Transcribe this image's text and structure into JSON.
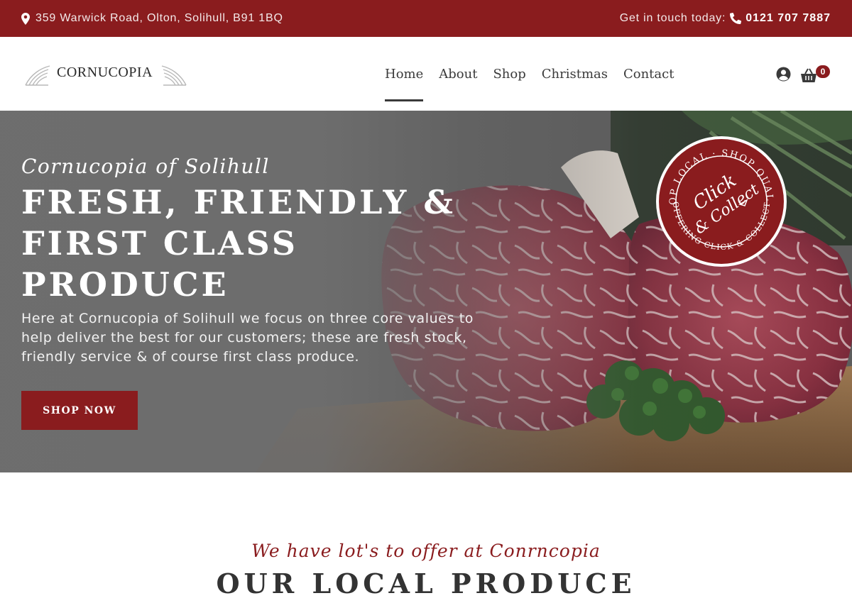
{
  "topbar": {
    "address": "359 Warwick Road, Olton, Solihull, B91 1BQ",
    "contact_prefix": "Get in touch today:",
    "phone": "0121 707 7887"
  },
  "header": {
    "logo_text": "CORNUCOPIA",
    "nav": [
      {
        "label": "Home",
        "active": true
      },
      {
        "label": "About"
      },
      {
        "label": "Shop"
      },
      {
        "label": "Christmas"
      },
      {
        "label": "Contact"
      }
    ],
    "cart_count": "0"
  },
  "hero": {
    "script_title": "Cornucopia of Solihull",
    "headline_line1": "FRESH, FRIENDLY &",
    "headline_line2": "FIRST CLASS",
    "headline_line3": "PRODUCE",
    "intro": "Here at Cornucopia of Solihull we focus on three core values to help deliver the best for our customers; these are fresh stock, friendly service & of course first class produce.",
    "cta_label": "SHOP NOW"
  },
  "badge": {
    "top_text": "SHOP LOCAL · SHOP QUALITY",
    "bottom_text": "OFFERING CLICK & COLLECT",
    "center_line1": "Click",
    "center_line2": "& Collect"
  },
  "section": {
    "script": "We have lot's to offer at Conrncopia",
    "title": "OUR LOCAL PRODUCE"
  },
  "colors": {
    "brand_red": "#8a1c1e",
    "text_dark": "#333333",
    "hero_gray": "#6e6e6e"
  },
  "icons": [
    "map-marker-icon",
    "phone-icon",
    "user-icon",
    "basket-icon",
    "wing-icon"
  ]
}
